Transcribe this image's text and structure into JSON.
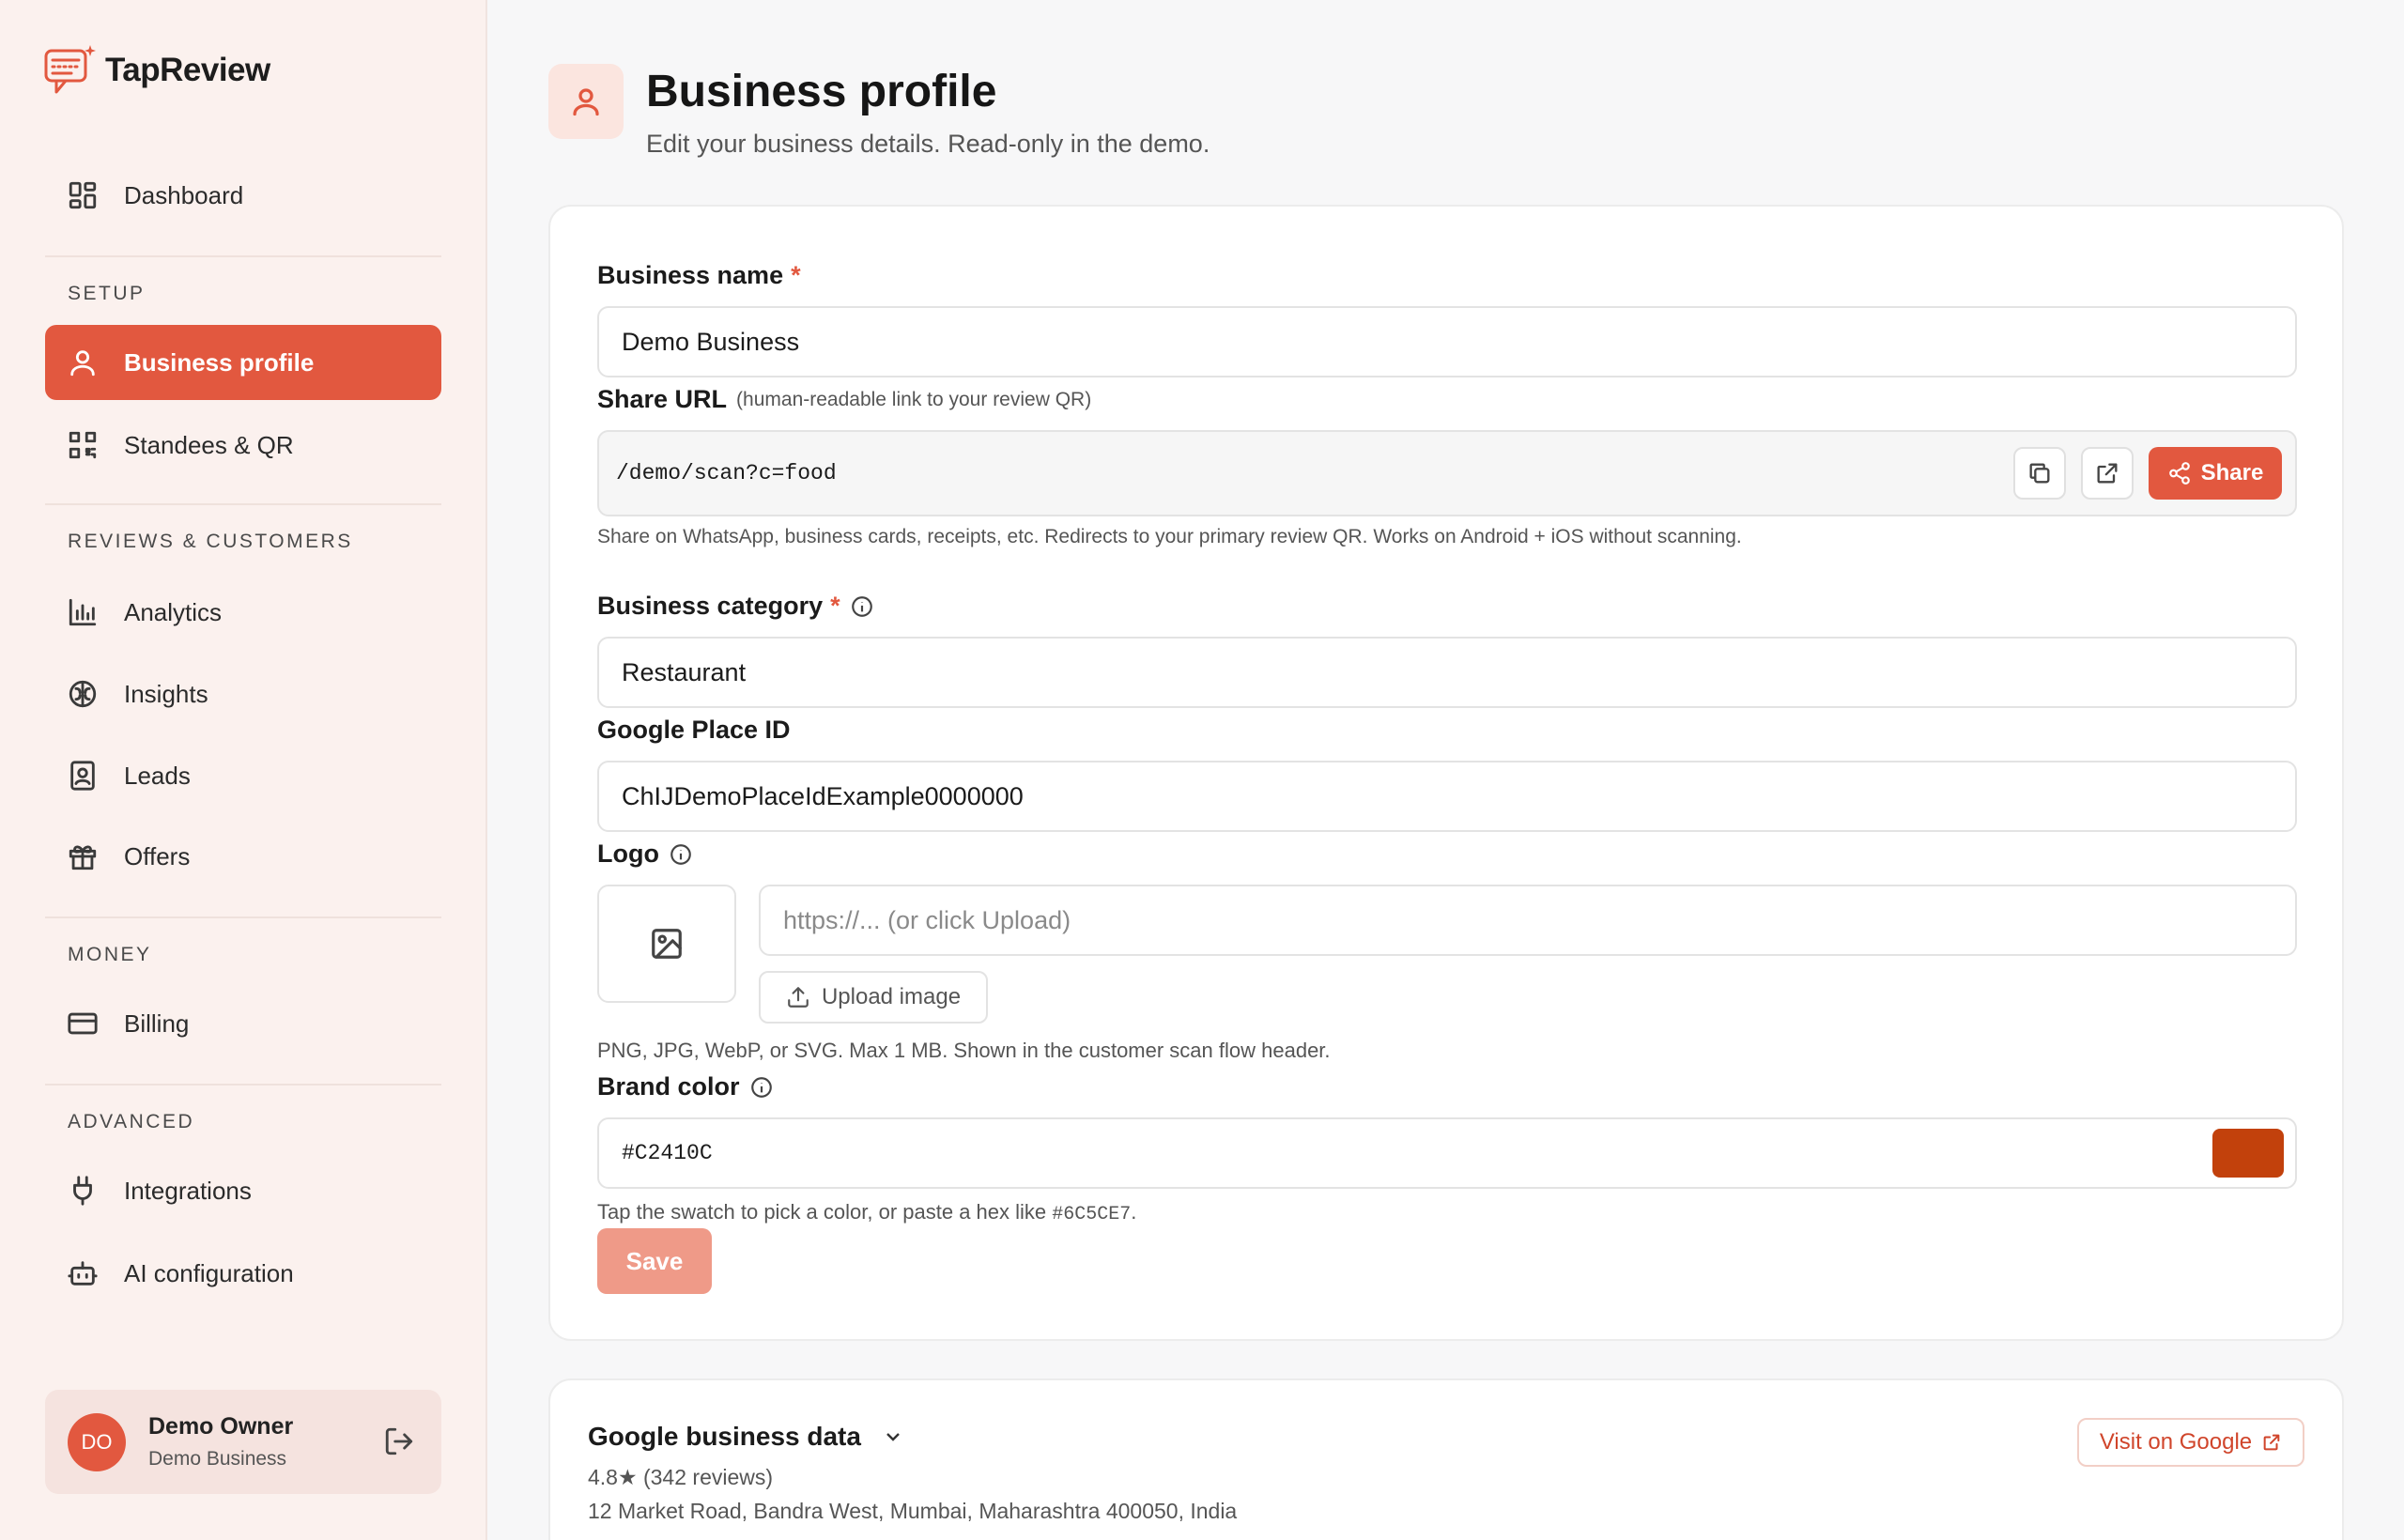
{
  "app": {
    "name": "TapReview"
  },
  "sidebar": {
    "dashboard": "Dashboard",
    "sections": {
      "setup": "SETUP",
      "reviews": "REVIEWS & CUSTOMERS",
      "money": "MONEY",
      "advanced": "ADVANCED"
    },
    "items": {
      "business_profile": "Business profile",
      "standees": "Standees & QR",
      "analytics": "Analytics",
      "insights": "Insights",
      "leads": "Leads",
      "offers": "Offers",
      "billing": "Billing",
      "integrations": "Integrations",
      "ai_config": "AI configuration"
    },
    "active": "business_profile",
    "accent": "#e2583f"
  },
  "user": {
    "initials": "DO",
    "name": "Demo Owner",
    "business": "Demo Business"
  },
  "header": {
    "title": "Business profile",
    "subtitle": "Edit your business details. Read-only in the demo."
  },
  "form": {
    "business_name": {
      "label": "Business name",
      "required": "*",
      "value": "Demo Business"
    },
    "share_url": {
      "label": "Share URL",
      "hint": "(human-readable link to your review QR)",
      "value": "/demo/scan?c=food",
      "share_label": "Share",
      "help": "Share on WhatsApp, business cards, receipts, etc. Redirects to your primary review QR. Works on Android + iOS without scanning."
    },
    "category": {
      "label": "Business category",
      "required": "*",
      "value": "Restaurant"
    },
    "place_id": {
      "label": "Google Place ID",
      "value": "ChIJDemoPlaceIdExample0000000"
    },
    "logo": {
      "label": "Logo",
      "placeholder": "https://... (or click Upload)",
      "upload_label": "Upload image",
      "help": "PNG, JPG, WebP, or SVG. Max 1 MB. Shown in the customer scan flow header."
    },
    "brand_color": {
      "label": "Brand color",
      "value": "#C2410C",
      "swatch": "#C2410C",
      "help_prefix": "Tap the swatch to pick a color, or paste a hex like",
      "help_example": "#6C5CE7",
      "help_suffix": "."
    },
    "save_label": "Save"
  },
  "google_data": {
    "title": "Google business data",
    "rating": "4.8★ (342 reviews)",
    "address": "12 Market Road, Bandra West, Mumbai, Maharashtra 400050, India",
    "visit_label": "Visit on Google"
  }
}
